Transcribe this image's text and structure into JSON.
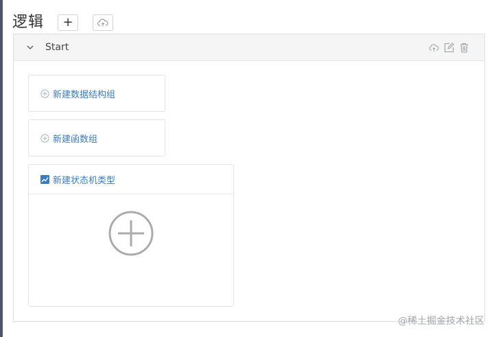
{
  "page": {
    "title": "逻辑"
  },
  "header": {
    "add_label": "+"
  },
  "panel": {
    "name": "Start",
    "cards": [
      {
        "label": "新建数据结构组",
        "icon": "plus-circle-icon"
      },
      {
        "label": "新建函数组",
        "icon": "plus-circle-icon"
      },
      {
        "label": "新建状态机类型",
        "icon": "chart-checkbox-icon"
      }
    ]
  },
  "watermark": "@稀土掘金技术社区",
  "colors": {
    "accent": "#3a7bc8",
    "border": "#dcdfe4",
    "icon_gray": "#9a9da3",
    "big_plus": "#ababab"
  }
}
